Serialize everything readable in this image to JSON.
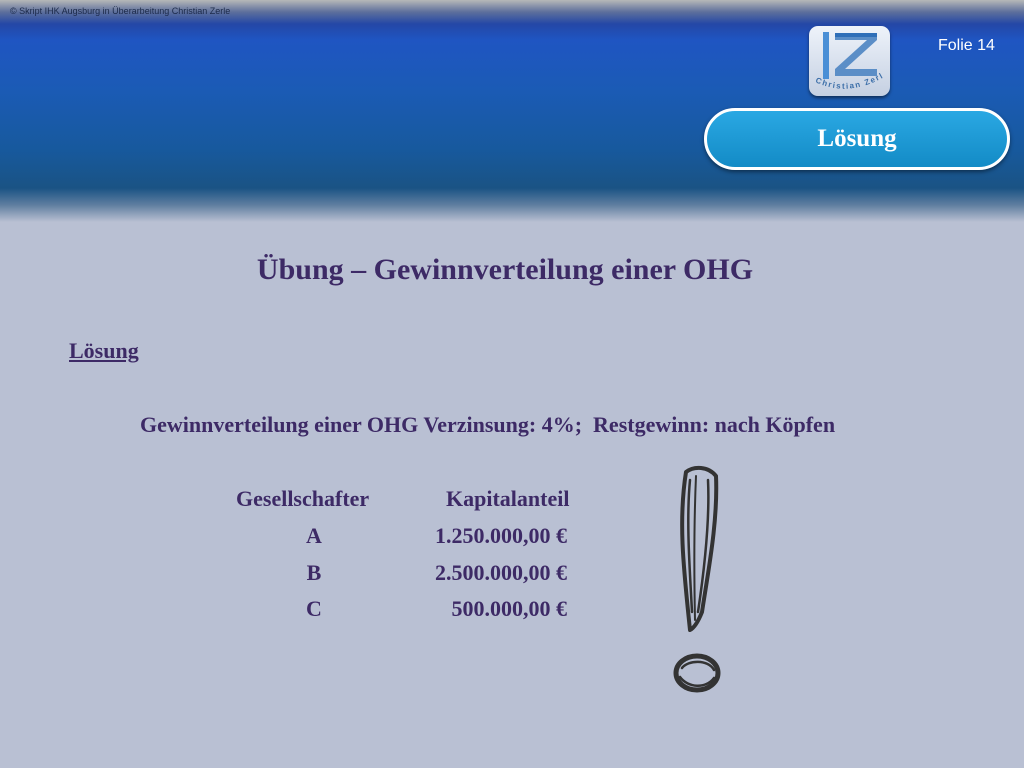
{
  "header": {
    "copyright": "© Skript IHK Augsburg in Überarbeitung Christian Zerle",
    "folie": "Folie 14",
    "logo_text": "Christian Zerle",
    "badge": "Lösung"
  },
  "content": {
    "title": "Übung – Gewinnverteilung einer OHG",
    "subtitle": "Lösung",
    "description": "Gewinnverteilung einer OHG Verzinsung: 4%;  Restgewinn: nach Köpfen",
    "table": {
      "headers": [
        "Gesellschafter",
        "Kapitalanteil"
      ],
      "rows": [
        {
          "partner": "A",
          "capital": "1.250.000,00 €"
        },
        {
          "partner": "B",
          "capital": "2.500.000,00 €"
        },
        {
          "partner": "C",
          "capital": "500.000,00 €"
        }
      ]
    }
  },
  "icons": {
    "logo": "cz-logo-icon",
    "exclamation": "exclamation-mark-icon"
  },
  "colors": {
    "text": "#3d2a66",
    "badge": "#1a9ad6",
    "background": "#b9c0d3"
  }
}
